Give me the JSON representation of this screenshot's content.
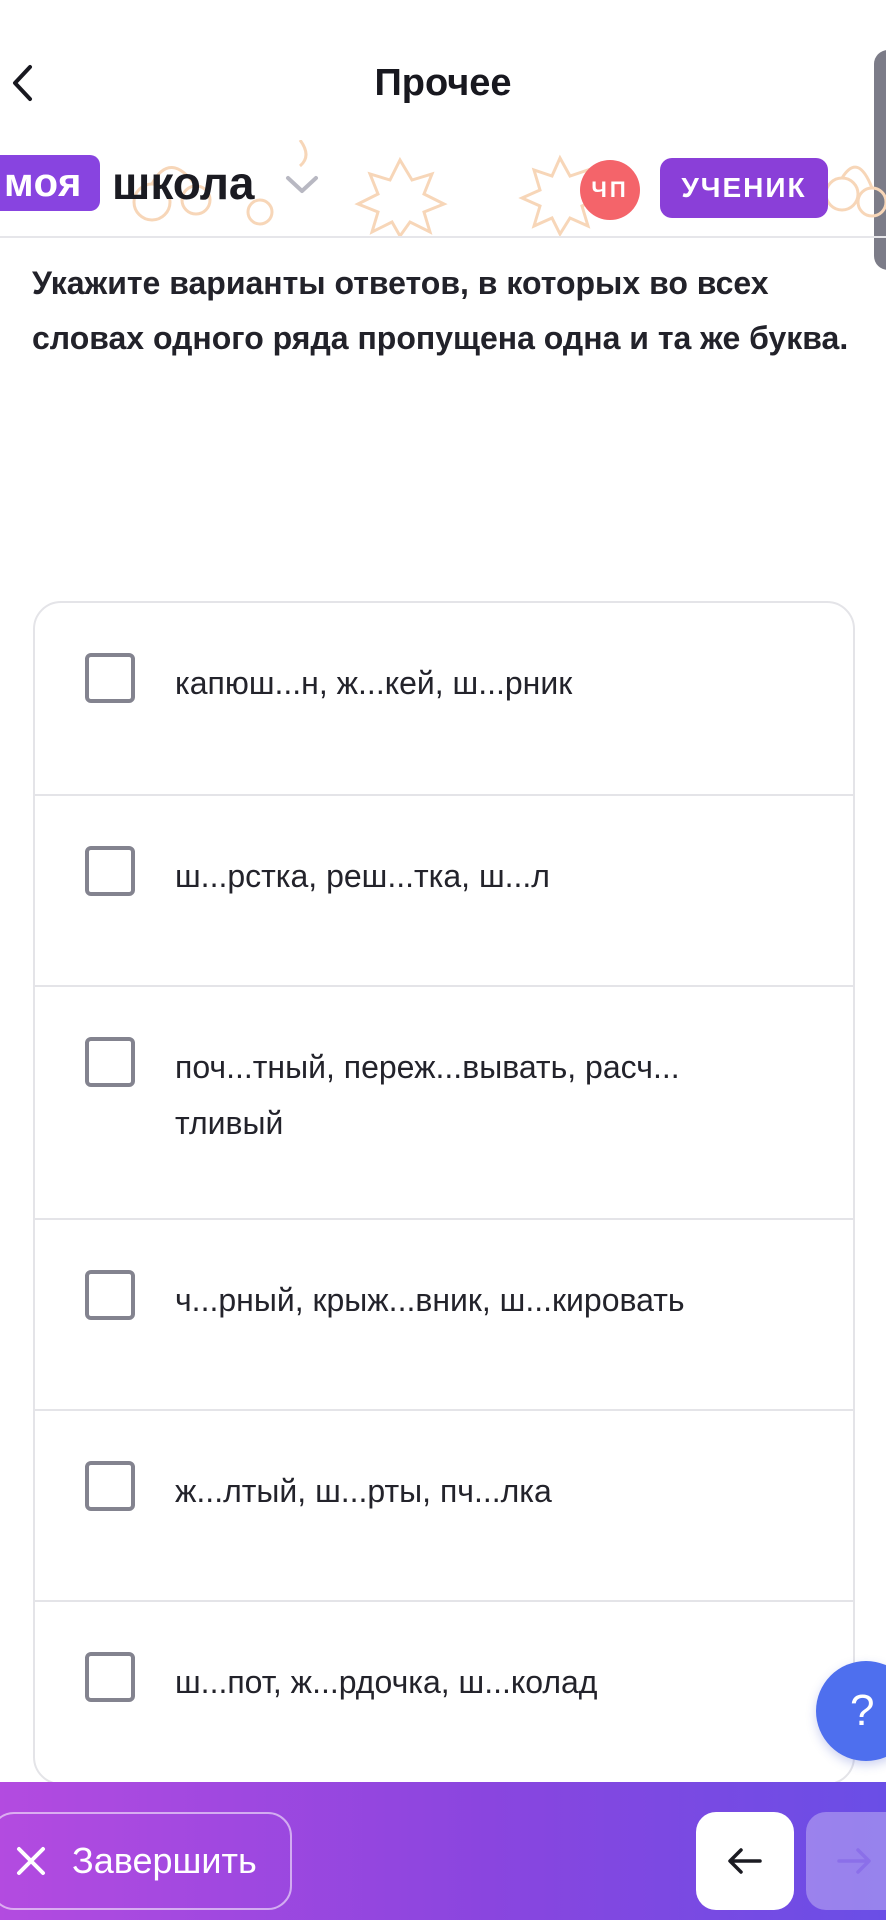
{
  "header": {
    "title": "Прочее",
    "back_icon": "chevron-left-icon"
  },
  "brand": {
    "logo_word1": "моя",
    "logo_word2": "школа",
    "chp_badge": "ЧП",
    "role": "УЧЕНИК",
    "accent_color": "#8844e0",
    "chp_color": "#f4646a"
  },
  "question": {
    "text": "Укажите варианты ответов, в которых во всех словах одного ряда пропущена одна и та же буква."
  },
  "options": [
    {
      "text": "капюш...н, ж...кей, ш...рник",
      "checked": false
    },
    {
      "text": "ш...рстка, реш...тка, ш...л",
      "checked": false
    },
    {
      "text": "поч...тный, переж...вывать, расч... тливый",
      "checked": false
    },
    {
      "text": "ч...рный, крыж...вник, ш...кировать",
      "checked": false
    },
    {
      "text": "ж...лтый, ш...рты, пч...лка",
      "checked": false
    },
    {
      "text": "ш...пот, ж...рдочка, ш...колад",
      "checked": false
    }
  ],
  "help": {
    "label": "?"
  },
  "footer": {
    "finish_label": "Завершить",
    "prev_icon": "arrow-left-icon",
    "next_icon": "arrow-right-icon",
    "gradient_colors": [
      "#b34be0",
      "#6a4ee6"
    ]
  }
}
